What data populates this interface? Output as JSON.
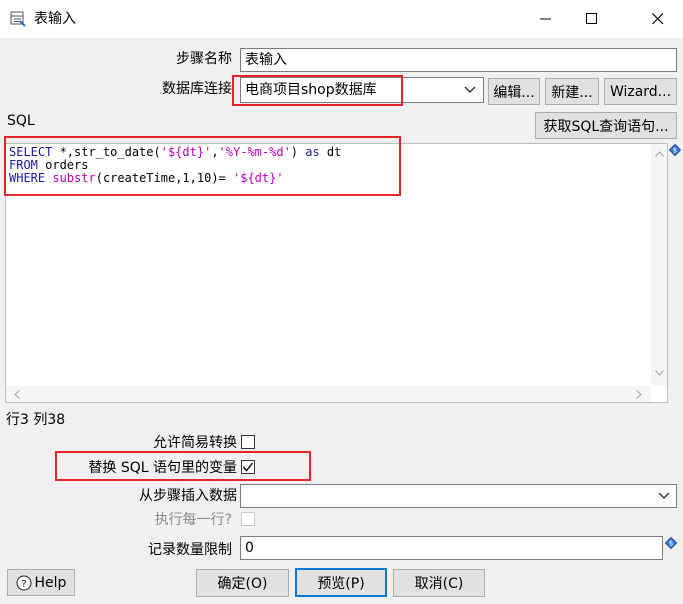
{
  "window": {
    "title": "表输入"
  },
  "form": {
    "step_name_label": "步骤名称",
    "step_name_value": "表输入",
    "connection_label": "数据库连接",
    "connection_value": "电商项目shop数据库",
    "edit_button": "编辑...",
    "new_button": "新建...",
    "wizard_button": "Wizard...",
    "sql_label": "SQL",
    "get_sql_button": "获取SQL查询语句...",
    "sql_lines": [
      [
        {
          "t": "SELECT",
          "c": "kw"
        },
        {
          "t": " *,str_to_date(",
          "c": ""
        },
        {
          "t": "'${dt}'",
          "c": "str"
        },
        {
          "t": ",",
          "c": ""
        },
        {
          "t": "'%Y-%m-%d'",
          "c": "str"
        },
        {
          "t": ") ",
          "c": ""
        },
        {
          "t": "as",
          "c": "kw"
        },
        {
          "t": " dt",
          "c": ""
        }
      ],
      [
        {
          "t": "FROM",
          "c": "kw"
        },
        {
          "t": " orders",
          "c": ""
        }
      ],
      [
        {
          "t": "WHERE",
          "c": "kw"
        },
        {
          "t": " ",
          "c": ""
        },
        {
          "t": "substr",
          "c": "fn"
        },
        {
          "t": "(createTime,1,10)= ",
          "c": ""
        },
        {
          "t": "'${dt}'",
          "c": "str"
        }
      ]
    ],
    "cursor_position": "行3 列38",
    "allow_lazy_conversion_label": "允许简易转换",
    "allow_lazy_conversion_checked": false,
    "replace_variables_label": "替换 SQL 语句里的变量",
    "replace_variables_checked": true,
    "insert_data_from_step_label": "从步骤插入数据",
    "insert_data_from_step_value": "",
    "execute_each_row_label": "执行每一行?",
    "execute_each_row_checked": false,
    "limit_label": "记录数量限制",
    "limit_value": "0"
  },
  "footer": {
    "help_button": "Help",
    "ok_button": "确定(O)",
    "preview_button": "预览(P)",
    "cancel_button": "取消(C)"
  },
  "colors": {
    "highlight_box": "#e8232a",
    "default_button_border": "#0078d7",
    "sql_keyword": "#1a1aa6",
    "sql_function_string": "#c000c0"
  }
}
